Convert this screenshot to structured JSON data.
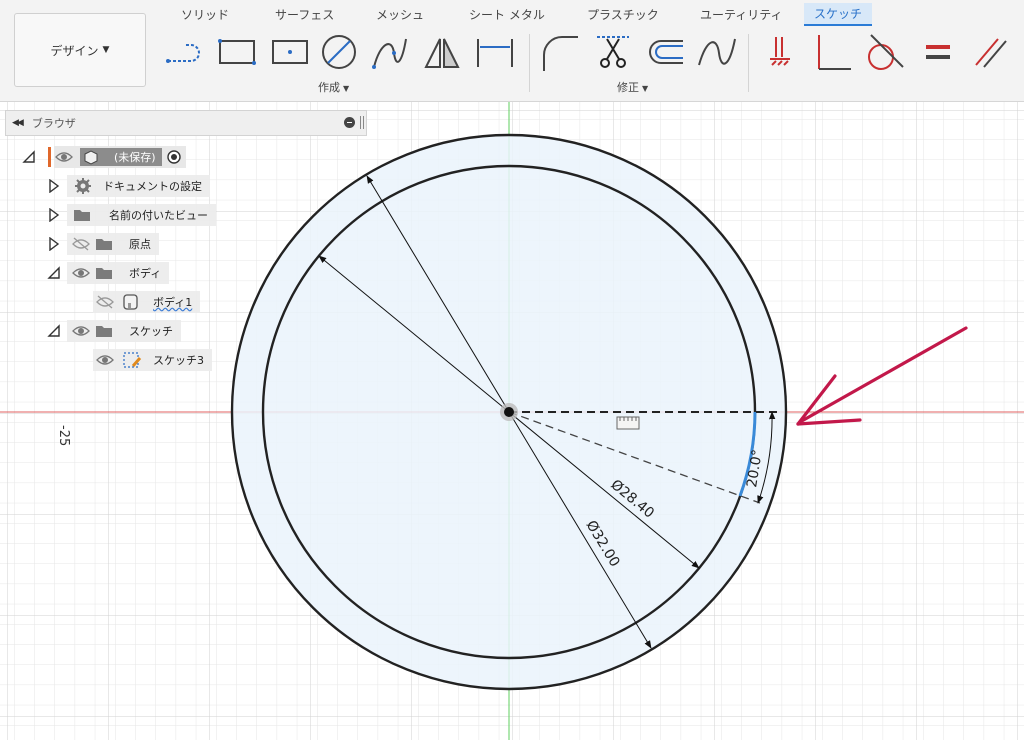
{
  "toolbar": {
    "workspace": "デザイン",
    "tabs": [
      "ソリッド",
      "サーフェス",
      "メッシュ",
      "シート メタル",
      "プラスチック",
      "ユーティリティ",
      "スケッチ"
    ],
    "create_label": "作成",
    "modify_label": "修正"
  },
  "browser": {
    "title": "ブラウザ",
    "root_label": "(未保存)",
    "nodes": [
      "ドキュメントの設定",
      "名前の付いたビュー",
      "原点",
      "ボディ",
      "ボディ1",
      "スケッチ",
      "スケッチ3"
    ]
  },
  "canvas": {
    "axis_label": "-25",
    "dim_inner": "Ø28.40",
    "dim_outer": "Ø32.00",
    "dim_angle": "20.0°"
  },
  "colors": {
    "accent": "#2a7bd6",
    "annotation_arrow": "#c2184a",
    "red_axis": "#e06060",
    "green_axis": "#5fcf5f",
    "sketch_fill": "#eaf3fc"
  }
}
